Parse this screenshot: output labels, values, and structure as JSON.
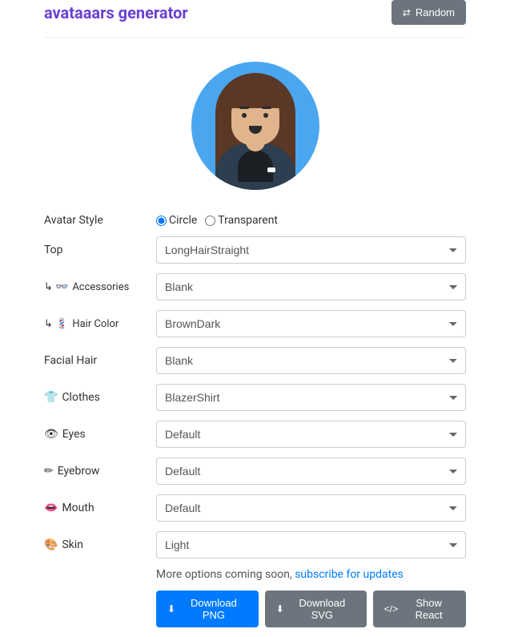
{
  "header": {
    "title": "avataaars generator",
    "random_label": "Random"
  },
  "style": {
    "label": "Avatar Style",
    "circle": "Circle",
    "transparent": "Transparent",
    "selected": "Circle"
  },
  "fields": {
    "top": {
      "label": "Top",
      "value": "LongHairStraight"
    },
    "accessories": {
      "icon": "↳ 👓",
      "label": "Accessories",
      "value": "Blank"
    },
    "hair_color": {
      "icon": "↳ 💈",
      "label": "Hair Color",
      "value": "BrownDark"
    },
    "facial_hair": {
      "label": "Facial Hair",
      "value": "Blank"
    },
    "clothes": {
      "icon": "👕",
      "label": "Clothes",
      "value": "BlazerShirt"
    },
    "eyes": {
      "icon": "👁",
      "label": "Eyes",
      "value": "Default"
    },
    "eyebrow": {
      "icon": "✏",
      "label": "Eyebrow",
      "value": "Default"
    },
    "mouth": {
      "icon": "👄",
      "label": "Mouth",
      "value": "Default"
    },
    "skin": {
      "icon": "🎨",
      "label": "Skin",
      "value": "Light"
    }
  },
  "footer": {
    "more_text": "More options coming soon, ",
    "subscribe_link": "subscribe for updates",
    "download_png": "Download PNG",
    "download_svg": "Download SVG",
    "show_react": "Show React"
  }
}
